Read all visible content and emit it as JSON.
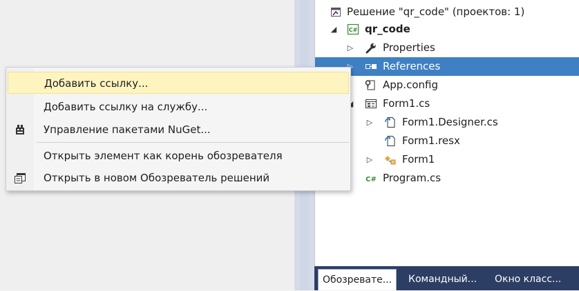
{
  "solution_explorer": {
    "solution_label": "Решение \"qr_code\"  (проектов: 1)",
    "items": [
      {
        "label": "qr_code",
        "icon": "csharp-project-icon"
      },
      {
        "label": "Properties",
        "icon": "wrench-icon"
      },
      {
        "label": "References",
        "icon": "references-icon"
      },
      {
        "label": "App.config",
        "icon": "config-file-icon"
      },
      {
        "label": "Form1.cs",
        "icon": "form-icon"
      },
      {
        "label": "Form1.Designer.cs",
        "icon": "csharp-file-icon"
      },
      {
        "label": "Form1.resx",
        "icon": "resx-file-icon"
      },
      {
        "label": "Form1",
        "icon": "class-icon"
      },
      {
        "label": "Program.cs",
        "icon": "csharp-file-icon"
      }
    ],
    "csharp_badge": "C#"
  },
  "bottom_tabs": [
    {
      "label": "Обозревате...",
      "active": true
    },
    {
      "label": "Командный...",
      "active": false
    },
    {
      "label": "Окно класс...",
      "active": false
    }
  ],
  "context_menu": {
    "items": [
      {
        "label": "Добавить ссылку...",
        "icon": ""
      },
      {
        "label": "Добавить ссылку на службу...",
        "icon": ""
      },
      {
        "label": "Управление пакетами NuGet...",
        "icon": "nuget-icon"
      },
      {
        "label": "Открыть элемент как корень обозревателя",
        "icon": ""
      },
      {
        "label": "Открыть в новом Обозреватель решений",
        "icon": "new-explorer-icon"
      }
    ]
  },
  "colors": {
    "selection": "#3f80c4",
    "menu_hover": "#fdf4bf",
    "tab_bar": "#2c3e63"
  }
}
